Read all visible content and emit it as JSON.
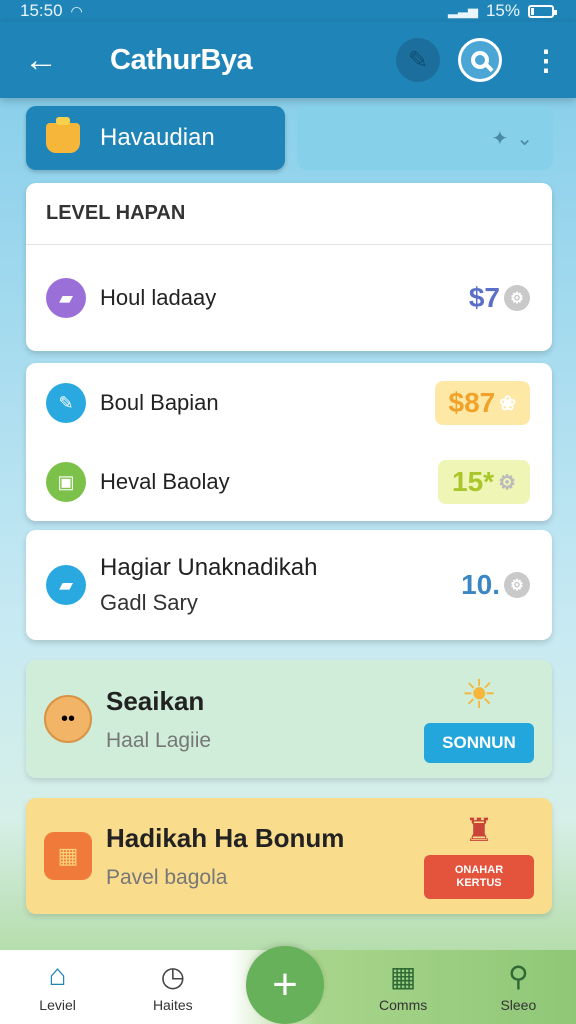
{
  "status_bar": {
    "time": "15:50",
    "battery": "15%",
    "battery_level": 0.15
  },
  "app_bar": {
    "title": "CathurBya"
  },
  "tabs": {
    "active": {
      "label": "Havaudian",
      "icon": "trophy-icon"
    },
    "inactive": {
      "label": ""
    }
  },
  "level_card": {
    "heading": "LEVEL HAPAN",
    "rows": [
      {
        "label": "Houl ladaay",
        "value": "$7",
        "icon": "bandage-icon",
        "color": "#9b6fd8"
      }
    ]
  },
  "reward_card": {
    "rows": [
      {
        "label": "Boul Bapian",
        "value": "$87",
        "icon": "pencil-icon",
        "color": "#2aa9e0"
      },
      {
        "label": "Heval Baolay",
        "value": "15*",
        "icon": "calendar-icon",
        "color": "#7cc24a"
      }
    ]
  },
  "bonus_card": {
    "title": "Hagiar Unaknadikah",
    "subtitle": "Gadl Sary",
    "value": "10.",
    "icon": "bandage-icon"
  },
  "promo_1": {
    "title": "Seaikan",
    "subtitle": "Haal Lagiie",
    "button": "SONNUN",
    "icon": "cookie-icon",
    "decor": "sun-icon"
  },
  "promo_2": {
    "title": "Hadikah Ha Bonum",
    "subtitle": "Pavel bagola",
    "button": "ONAHAR KERTUS",
    "icon": "waffle-icon",
    "decor": "chest-icon"
  },
  "bottom_nav": {
    "items": [
      {
        "label": "Leviel",
        "icon": "home-icon"
      },
      {
        "label": "Haites",
        "icon": "clock-icon"
      },
      {
        "label": "Comms",
        "icon": "grid-icon"
      },
      {
        "label": "Sleeo",
        "icon": "search-icon"
      }
    ],
    "fab": "+"
  }
}
